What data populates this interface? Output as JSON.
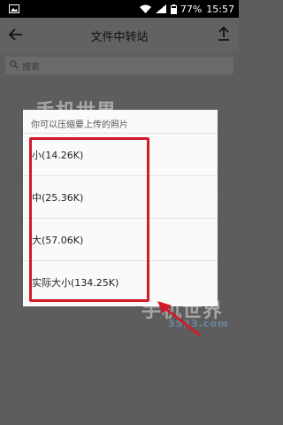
{
  "status_bar": {
    "battery_percent": "77%",
    "time": "15:57"
  },
  "toolbar": {
    "title": "文件中转站",
    "back_icon": "arrow-left-icon",
    "upload_icon": "upload-icon"
  },
  "search": {
    "placeholder": "搜索"
  },
  "dialog": {
    "title": "你可以压缩要上传的照片",
    "options": [
      {
        "label": "小(14.26K)"
      },
      {
        "label": "中(25.36K)"
      },
      {
        "label": "大(57.06K)"
      },
      {
        "label": "实际大小(134.25K)"
      }
    ]
  },
  "colors": {
    "highlight": "#d21b26",
    "overlay": "#5d5d5d",
    "dialog_bg": "#fafafa"
  }
}
